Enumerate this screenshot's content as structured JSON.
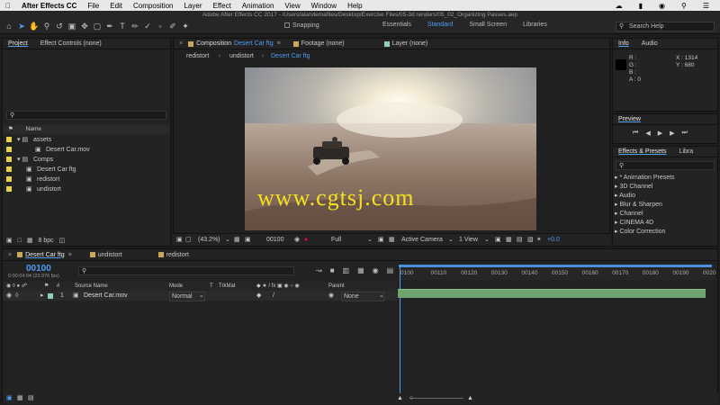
{
  "menubar": {
    "apple": "",
    "app_name": "After Effects CC",
    "items": [
      "File",
      "Edit",
      "Composition",
      "Layer",
      "Effect",
      "Animation",
      "View",
      "Window",
      "Help"
    ]
  },
  "window_title": "Adobe After Effects CC 2017 - /Users/alandemafiles/Desktop/Exercise Files/05-3d renders/05_02_Organizing Passes.aep",
  "toolbar": {
    "snapping_label": "Snapping",
    "workspaces": [
      "Essentials",
      "Standard",
      "Small Screen",
      "Libraries"
    ],
    "active_workspace": "Standard",
    "search_help": "Search Help"
  },
  "project_panel": {
    "tab_project": "Project",
    "tab_effect_controls": "Effect Controls (none)",
    "col_name": "Name",
    "items": [
      {
        "label": "assets",
        "type": "folder",
        "color": "#e8d24a",
        "indent": 0
      },
      {
        "label": "Desert Car.mov",
        "type": "footage",
        "color": "#e8d24a",
        "indent": 2
      },
      {
        "label": "Comps",
        "type": "folder",
        "color": "#e8d24a",
        "indent": 0
      },
      {
        "label": "Desert Car ftg",
        "type": "comp",
        "color": "#e8d24a",
        "indent": 1
      },
      {
        "label": "redistort",
        "type": "comp",
        "color": "#e8d24a",
        "indent": 1
      },
      {
        "label": "undistort",
        "type": "comp",
        "color": "#e8d24a",
        "indent": 1
      }
    ],
    "bpc": "8 bpc"
  },
  "comp_panel": {
    "tab_label": "Composition",
    "comp_name": "Desert Car ftg",
    "tab_footage": "Footage (none)",
    "tab_layer": "Layer (none)",
    "breadcrumbs": [
      "redistort",
      "undistort",
      "Desert Car ftg"
    ],
    "zoom": "(43.2%)",
    "timecode": "00100",
    "resolution": "Full",
    "camera": "Active Camera",
    "view": "1 View",
    "exposure": "+0.0",
    "watermark": "www.cgtsj.com"
  },
  "info_panel": {
    "tab_info": "Info",
    "tab_audio": "Audio",
    "r": "R :",
    "g": "G :",
    "b": "B :",
    "a": "A : 0",
    "x": "X : 1314",
    "y": "Y : 680"
  },
  "preview_panel": {
    "title": "Preview"
  },
  "effects_panel": {
    "title": "Effects & Presets",
    "tab_libraries": "Libra",
    "items": [
      "* Animation Presets",
      "3D Channel",
      "Audio",
      "Blur & Sharpen",
      "Channel",
      "CINEMA 4D",
      "Color Correction"
    ]
  },
  "timeline": {
    "tabs": [
      {
        "label": "Desert Car ftg",
        "active": true
      },
      {
        "label": "undistort",
        "active": false
      },
      {
        "label": "redistort",
        "active": false
      }
    ],
    "current_time": "00100",
    "time_fps": "0:00:04:04 (23.976 fps)",
    "columns": {
      "source_name": "Source Name",
      "mode": "Mode",
      "t": "T",
      "trkmat": "TrkMat",
      "parent": "Parent"
    },
    "layer": {
      "index": "1",
      "name": "Desert Car.mov",
      "mode": "Normal",
      "parent": "None"
    },
    "ruler": [
      "0100",
      "00110",
      "00120",
      "00130",
      "00140",
      "00150",
      "00160",
      "00170",
      "00180",
      "00190",
      "0020"
    ]
  },
  "colors": {
    "accent": "#4f9cf5",
    "label_yellow": "#e8d24a",
    "layer_bar": "#6ea36e",
    "layer_label": "#8fd0b8"
  }
}
